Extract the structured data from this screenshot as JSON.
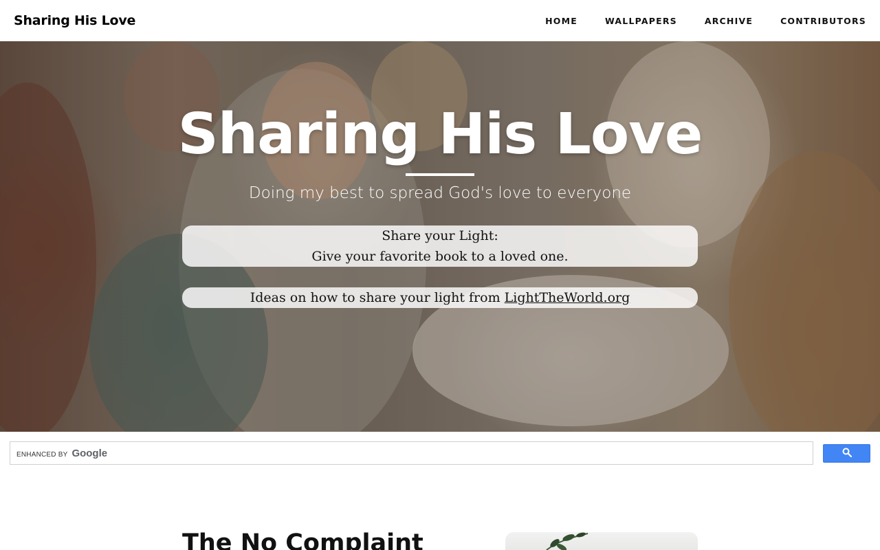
{
  "nav": {
    "brand": "Sharing His Love",
    "links": [
      "HOME",
      "WALLPAPERS",
      "ARCHIVE",
      "CONTRIBUTORS"
    ]
  },
  "hero": {
    "title": "Sharing His Love",
    "subtitle": "Doing my best to spread God's love to everyone",
    "box1_line1": "Share your Light:",
    "box1_line2": "Give your favorite book to a loved one.",
    "box2_text": "Ideas on how to share your light from",
    "box2_link": "LightTheWorld.org"
  },
  "search": {
    "enhanced_by": "ENHANCED BY",
    "provider": "Google",
    "value": "",
    "button_color": "#4285f4"
  },
  "post": {
    "title": "The No Complaint"
  }
}
